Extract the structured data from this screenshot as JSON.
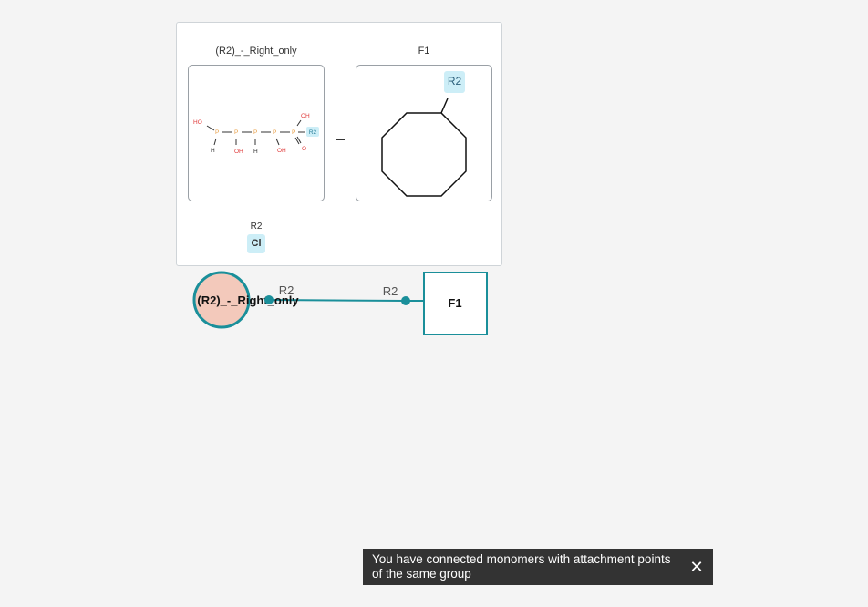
{
  "preview": {
    "left_monomer_title": "(R2)_-_Right_only",
    "right_monomer_title": "F1",
    "left_structure": {
      "atoms": [
        "HO",
        "P",
        "P",
        "P",
        "P",
        "P",
        "H",
        "OH",
        "H",
        "OH",
        "OH",
        "O"
      ],
      "attachment": "R2"
    },
    "right_structure": {
      "attachment": "R2"
    },
    "attachment_group_label": "R2",
    "leaving_group": "Cl"
  },
  "canvas": {
    "left_node_label": "(R2)_-_Right_only",
    "left_attachment_label": "R2",
    "right_attachment_label": "R2",
    "right_node_label": "F1",
    "colors": {
      "accent": "#1a8f9a",
      "left_node_fill": "#f3c9bb",
      "hetero_atom": "#e03a3a",
      "phosphorus": "#e8a04a",
      "attachment_chip": "#cdeef7"
    }
  },
  "toast": {
    "message": "You have connected monomers with attachment points of the same group",
    "close_icon": "close-icon"
  }
}
